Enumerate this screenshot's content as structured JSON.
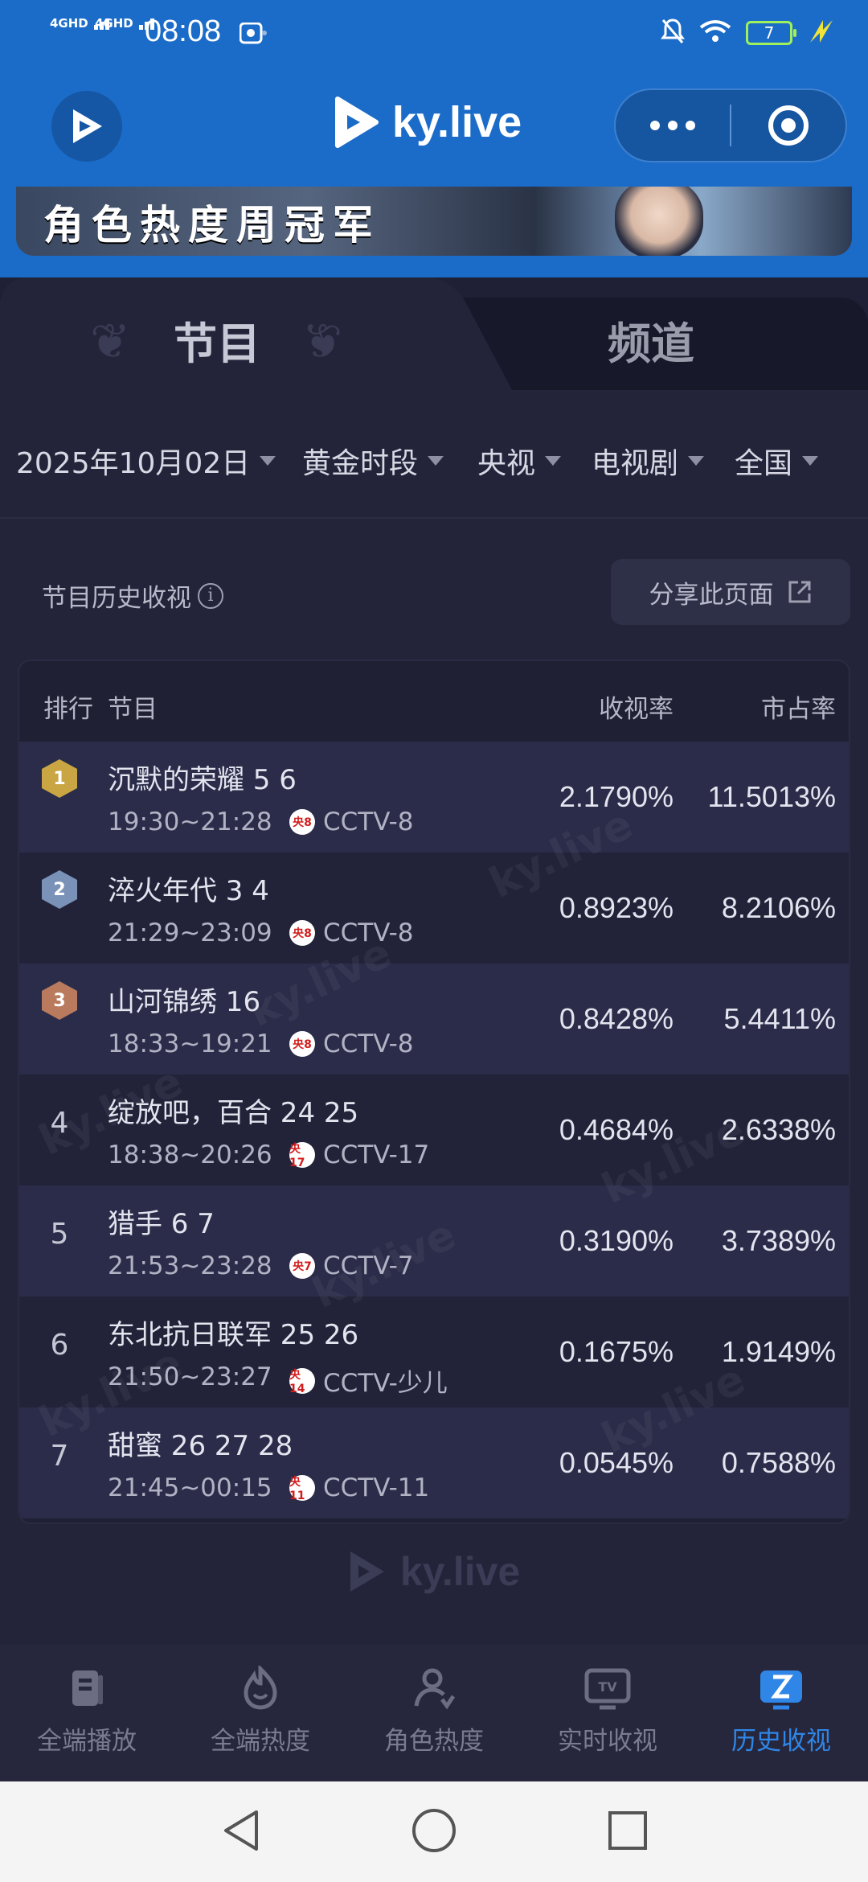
{
  "status_bar": {
    "signal1": "4GHD",
    "signal2": "4GHD",
    "time": "08:08",
    "battery": "7"
  },
  "header": {
    "brand": "ky.live"
  },
  "banner": {
    "text": "角色热度周冠军"
  },
  "tabs": [
    {
      "label": "节目",
      "active": true
    },
    {
      "label": "频道",
      "active": false
    }
  ],
  "filters": [
    {
      "label": "2025年10月02日"
    },
    {
      "label": "黄金时段"
    },
    {
      "label": "央视"
    },
    {
      "label": "电视剧"
    },
    {
      "label": "全国"
    }
  ],
  "section": {
    "title": "节目历史收视",
    "share_label": "分享此页面"
  },
  "table": {
    "headers": {
      "rank": "排行",
      "program": "节目",
      "rating": "收视率",
      "share": "市占率"
    },
    "rows": [
      {
        "rank": "1",
        "program": "沉默的荣耀 5 6",
        "time": "19:30~21:28",
        "channel_logo": "央8",
        "channel": "CCTV-8",
        "rating": "2.1790%",
        "share": "11.5013%"
      },
      {
        "rank": "2",
        "program": "淬火年代 3 4",
        "time": "21:29~23:09",
        "channel_logo": "央8",
        "channel": "CCTV-8",
        "rating": "0.8923%",
        "share": "8.2106%"
      },
      {
        "rank": "3",
        "program": "山河锦绣 16",
        "time": "18:33~19:21",
        "channel_logo": "央8",
        "channel": "CCTV-8",
        "rating": "0.8428%",
        "share": "5.4411%"
      },
      {
        "rank": "4",
        "program": "绽放吧，百合 24 25",
        "time": "18:38~20:26",
        "channel_logo": "央17",
        "channel": "CCTV-17",
        "rating": "0.4684%",
        "share": "2.6338%"
      },
      {
        "rank": "5",
        "program": "猎手 6 7",
        "time": "21:53~23:28",
        "channel_logo": "央7",
        "channel": "CCTV-7",
        "rating": "0.3190%",
        "share": "3.7389%"
      },
      {
        "rank": "6",
        "program": "东北抗日联军 25 26",
        "time": "21:50~23:27",
        "channel_logo": "央14",
        "channel": "CCTV-少儿",
        "rating": "0.1675%",
        "share": "1.9149%"
      },
      {
        "rank": "7",
        "program": "甜蜜 26 27 28",
        "time": "21:45~00:15",
        "channel_logo": "央11",
        "channel": "CCTV-11",
        "rating": "0.0545%",
        "share": "0.7588%"
      }
    ],
    "medal_colors": [
      "#c9a543",
      "#7a92b8",
      "#b97a5e"
    ]
  },
  "watermark": "ky.live",
  "footer": {
    "brand": "ky.live"
  },
  "bottom_nav": [
    {
      "label": "全端播放",
      "icon": "book-icon",
      "active": false
    },
    {
      "label": "全端热度",
      "icon": "flame-icon",
      "active": false
    },
    {
      "label": "角色热度",
      "icon": "person-icon",
      "active": false
    },
    {
      "label": "实时收视",
      "icon": "tv-icon",
      "active": false
    },
    {
      "label": "历史收视",
      "icon": "history-icon",
      "active": true
    }
  ],
  "colors": {
    "accent": "#2f86e6",
    "header": "#1b6cc8",
    "background": "#1f2035"
  }
}
